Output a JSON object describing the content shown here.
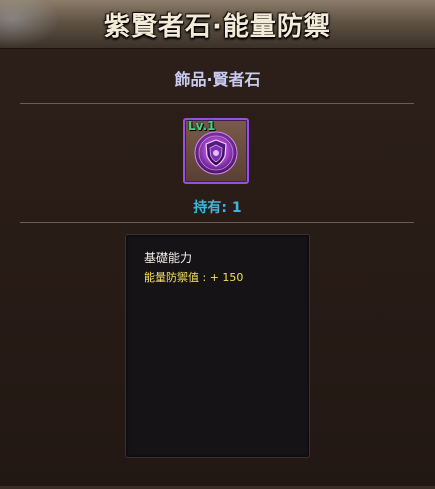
{
  "window": {
    "title": "紫賢者石·能量防禦"
  },
  "item": {
    "category": "飾品·賢者石",
    "level_label": "Lv.1",
    "icon": "purple-shield-gem-icon",
    "owned_text": "持有: 1"
  },
  "stats": {
    "heading": "基礎能力",
    "line": "能量防禦值 : + 150"
  },
  "colors": {
    "rarity_border": "#9a4fe0",
    "level_text": "#3fd27f",
    "owned_text": "#3cb6e0",
    "stat_value": "#f3e25a",
    "subtitle": "#c9cbf0"
  }
}
